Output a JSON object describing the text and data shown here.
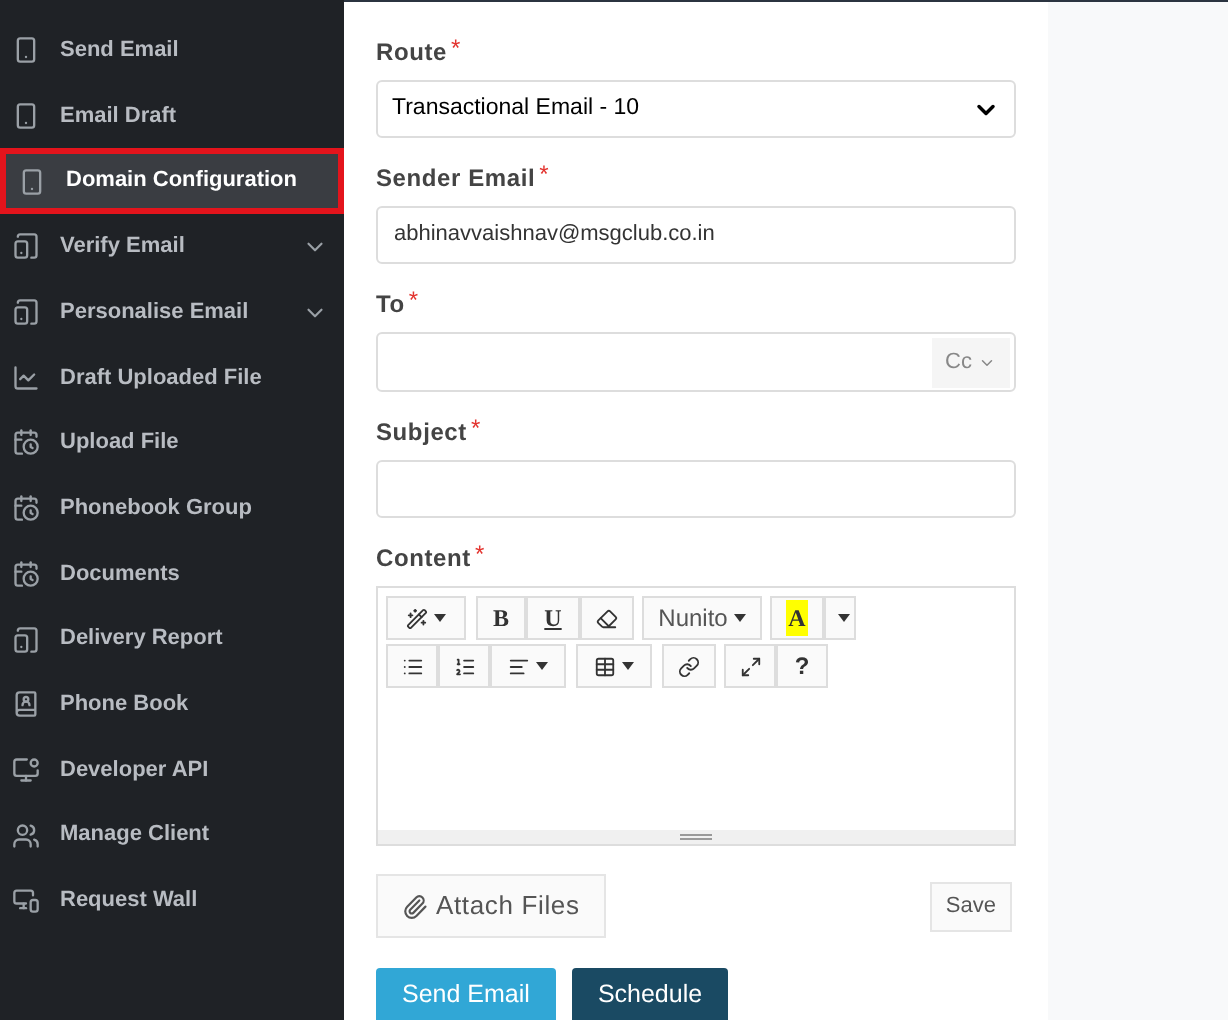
{
  "sidebar": {
    "items": [
      {
        "label": "Send Email",
        "kind": "message",
        "expandable": false,
        "selected": false
      },
      {
        "label": "Email Draft",
        "kind": "message",
        "expandable": false,
        "selected": false
      },
      {
        "label": "Domain Configuration",
        "kind": "message",
        "expandable": false,
        "selected": true
      },
      {
        "label": "Verify Email",
        "kind": "device",
        "expandable": true,
        "selected": false
      },
      {
        "label": "Personalise Email",
        "kind": "device",
        "expandable": true,
        "selected": false
      },
      {
        "label": "Draft Uploaded File",
        "kind": "chart",
        "expandable": false,
        "selected": false
      },
      {
        "label": "Upload File",
        "kind": "schedule",
        "expandable": false,
        "selected": false
      },
      {
        "label": "Phonebook Group",
        "kind": "schedule",
        "expandable": false,
        "selected": false
      },
      {
        "label": "Documents",
        "kind": "schedule",
        "expandable": false,
        "selected": false
      },
      {
        "label": "Delivery Report",
        "kind": "device",
        "expandable": false,
        "selected": false
      },
      {
        "label": "Phone Book",
        "kind": "contacts",
        "expandable": false,
        "selected": false
      },
      {
        "label": "Developer API",
        "kind": "code",
        "expandable": false,
        "selected": false
      },
      {
        "label": "Manage Client",
        "kind": "people",
        "expandable": false,
        "selected": false
      },
      {
        "label": "Request Wall",
        "kind": "screen",
        "expandable": false,
        "selected": false
      }
    ]
  },
  "form": {
    "route": {
      "label": "Route",
      "required_mark": "*",
      "value": "Transactional Email - 10"
    },
    "sender_email": {
      "label": "Sender Email",
      "required_mark": "*",
      "value": "abhinavvaishnav@msgclub.co.in"
    },
    "to": {
      "label": "To",
      "required_mark": "*",
      "cc": "Cc"
    },
    "subject": {
      "label": "Subject",
      "required_mark": "*"
    },
    "content": {
      "label": "Content",
      "required_mark": "*",
      "toolbar": {
        "bold": "B",
        "underline": "U",
        "font": "Nunito",
        "highlight": "A",
        "help": "?"
      }
    },
    "attach": "Attach Files",
    "save": "Save",
    "send": "Send Email",
    "schedule": "Schedule"
  }
}
